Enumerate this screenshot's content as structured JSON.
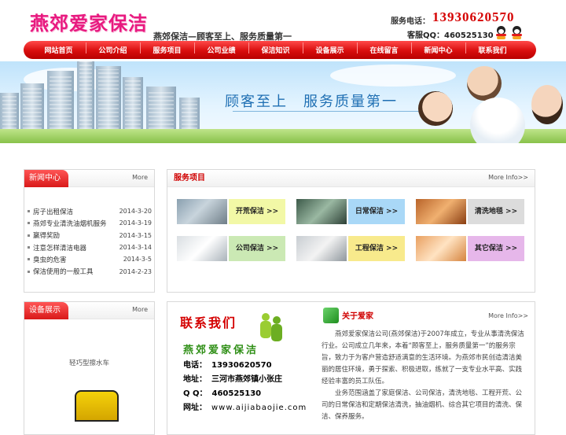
{
  "header": {
    "logo": "燕郊爱家保洁",
    "slogan": "燕郊保洁—顾客至上、服务质量第一",
    "phone_label": "服务电话：",
    "phone": "13930620570",
    "qq": "客服QQ：460525130"
  },
  "nav": [
    "网站首页",
    "公司介绍",
    "服务项目",
    "公司业绩",
    "保洁知识",
    "设备展示",
    "在线留言",
    "新闻中心",
    "联系我们"
  ],
  "banner": {
    "text": "顾客至上　服务质量第一"
  },
  "news": {
    "title": "新闻中心",
    "more": "More",
    "items": [
      {
        "title": "房子出租保洁",
        "date": "2014-3-20"
      },
      {
        "title": "燕郊专业清洗油烟机服务",
        "date": "2014-3-19"
      },
      {
        "title": "赢得奖励",
        "date": "2014-3-15"
      },
      {
        "title": "注意怎样清洁电器",
        "date": "2014-3-14"
      },
      {
        "title": "臭虫的危害",
        "date": "2014-3-5"
      },
      {
        "title": "保洁使用的一般工具",
        "date": "2014-2-23"
      }
    ]
  },
  "services": {
    "title": "服务项目",
    "more": "More Info>>",
    "items": [
      {
        "label": "开荒保洁 >>",
        "color": "#f2f8a6"
      },
      {
        "label": "日常保洁 >>",
        "color": "#a9d8f7"
      },
      {
        "label": "清洗地毯 >>",
        "color": "#dcdcdc"
      },
      {
        "label": "公司保洁 >>",
        "color": "#cbe9b4"
      },
      {
        "label": "工程保洁 >>",
        "color": "#f8ea8c"
      },
      {
        "label": "其它保洁 >>",
        "color": "#e6b7ea"
      }
    ]
  },
  "devices": {
    "title": "设备展示",
    "more": "More",
    "caption": "轻巧型擦水车"
  },
  "contact": {
    "title": "联系我们",
    "company": "燕郊爱家保洁",
    "phone_label": "电话：",
    "phone": "13930620570",
    "addr_label": "地址：",
    "addr": "三河市燕郊镇小张庄",
    "qq_label": "Q Q：",
    "qq": "460525130",
    "web_label": "网址：",
    "web": "www.aijiabaojie.com"
  },
  "about": {
    "title": "关于爱家",
    "more": "More Info>>",
    "p1": "燕郊爱家保洁公司(燕郊保洁)于2007年成立，专业从事清洗保洁行业。公司成立几年来，本着“顾客至上，服务质量第一”的服务宗旨，致力于为客户营造舒适满意的生活环境。为燕郊市民创造清洁美丽的居住环境，勇于探索、积极进取，练就了一支专业水平高、实践经验丰富的员工队伍。",
    "p2": "业务范围涵盖了家庭保洁、公司保洁，清洗地毯、工程开荒、公司的日常保洁和定期保洁清洗，抽油烟机、综合其它项目的清洗、保洁、保养服务。"
  }
}
